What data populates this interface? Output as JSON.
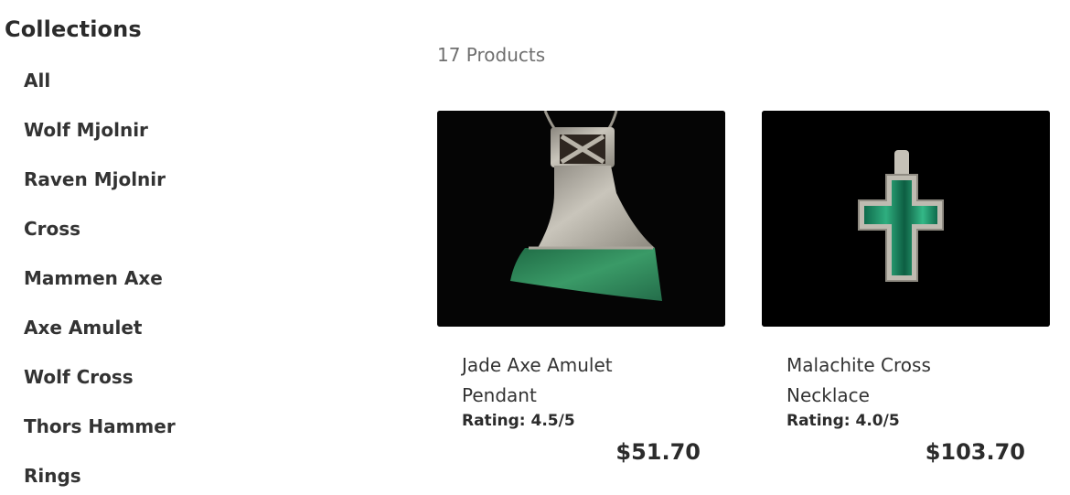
{
  "sidebar": {
    "title": "Collections",
    "items": [
      {
        "label": "All"
      },
      {
        "label": "Wolf Mjolnir"
      },
      {
        "label": "Raven Mjolnir"
      },
      {
        "label": "Cross"
      },
      {
        "label": "Mammen Axe"
      },
      {
        "label": "Axe Amulet"
      },
      {
        "label": "Wolf Cross"
      },
      {
        "label": "Thors Hammer"
      },
      {
        "label": "Rings"
      }
    ]
  },
  "main": {
    "product_count": "17 Products",
    "products": [
      {
        "name": "Jade Axe Amulet Pendant",
        "rating": "Rating: 4.5/5",
        "price": "$51.70",
        "image": "jade-axe-pendant-photo"
      },
      {
        "name": "Malachite Cross Necklace",
        "rating": "Rating: 4.0/5",
        "price": "$103.70",
        "image": "malachite-cross-pendant-photo"
      }
    ]
  },
  "colors": {
    "background": "#ffffff",
    "text": "#2b2b2b",
    "muted": "#6f6f6f",
    "image_bg": "#050505",
    "jade": "#2f8f5c",
    "silver": "#b8b4aa"
  }
}
